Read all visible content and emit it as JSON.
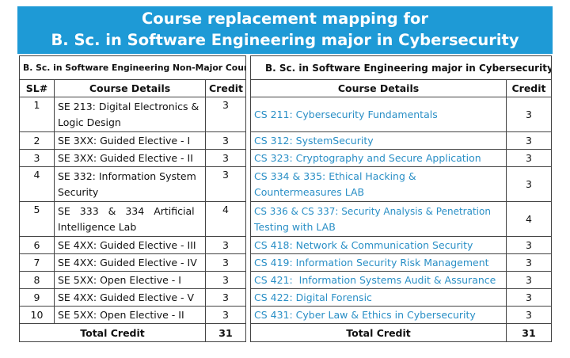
{
  "title": {
    "line1": "Course replacement mapping for",
    "line2": "B. Sc. in Software Engineering major in Cybersecurity"
  },
  "left": {
    "section": "B. Sc. in Software Engineering Non-Major Courses",
    "headers": {
      "sl": "SL#",
      "details": "Course Details",
      "credit": "Credit"
    },
    "rows": [
      {
        "sl": "1",
        "l1": "SE 213: Digital Electronics &",
        "l2": "Logic Design",
        "credit": "3"
      },
      {
        "sl": "2",
        "l1": "SE 3XX: Guided Elective - I",
        "credit": "3"
      },
      {
        "sl": "3",
        "l1": "SE 3XX: Guided Elective - II",
        "credit": "3"
      },
      {
        "sl": "4",
        "l1": "SE 332: Information System",
        "l2": "Security",
        "credit": "3"
      },
      {
        "sl": "5",
        "l1": "SE 333 & 334 Artificial",
        "l2": "Intelligence Lab",
        "credit": "4"
      },
      {
        "sl": "6",
        "l1": "SE 4XX: Guided Elective - III",
        "credit": "3"
      },
      {
        "sl": "7",
        "l1": "SE 4XX: Guided Elective - IV",
        "credit": "3"
      },
      {
        "sl": "8",
        "l1": "SE 5XX: Open Elective - I",
        "credit": "3"
      },
      {
        "sl": "9",
        "l1": "SE 4XX: Guided Elective - V",
        "credit": "3"
      },
      {
        "sl": "10",
        "l1": "SE 5XX: Open Elective - II",
        "credit": "3"
      }
    ],
    "total_label": "Total Credit",
    "total_value": "31"
  },
  "right": {
    "section": "B. Sc. in Software Engineering major in Cybersecurity",
    "headers": {
      "details": "Course Details",
      "credit": "Credit"
    },
    "rows": [
      {
        "l1": "CS 211: Cybersecurity Fundamentals",
        "credit": "3"
      },
      {
        "l1": "CS 312: SystemSecurity",
        "credit": "3"
      },
      {
        "l1": "CS 323: Cryptography and Secure Application",
        "credit": "3"
      },
      {
        "l1": "CS 334 & 335: Ethical Hacking &",
        "l2": "Countermeasures LAB",
        "credit": "3"
      },
      {
        "l1": "CS 336 & CS 337: Security Analysis & Penetration",
        "l2": "Testing with LAB",
        "credit": "4"
      },
      {
        "l1": "CS 418: Network & Communication Security",
        "credit": "3"
      },
      {
        "l1": "CS 419: Information Security Risk Management",
        "credit": "3"
      },
      {
        "l1": "CS 421:  Information Systems Audit & Assurance",
        "credit": "3"
      },
      {
        "l1": "CS 422: Digital Forensic",
        "credit": "3"
      },
      {
        "l1": "CS 431: Cyber Law & Ethics in Cybersecurity",
        "credit": "3"
      }
    ],
    "total_label": "Total Credit",
    "total_value": "31"
  },
  "colors": {
    "banner": "#1e9ad6",
    "link": "#2a8fc6",
    "border": "#444444"
  }
}
